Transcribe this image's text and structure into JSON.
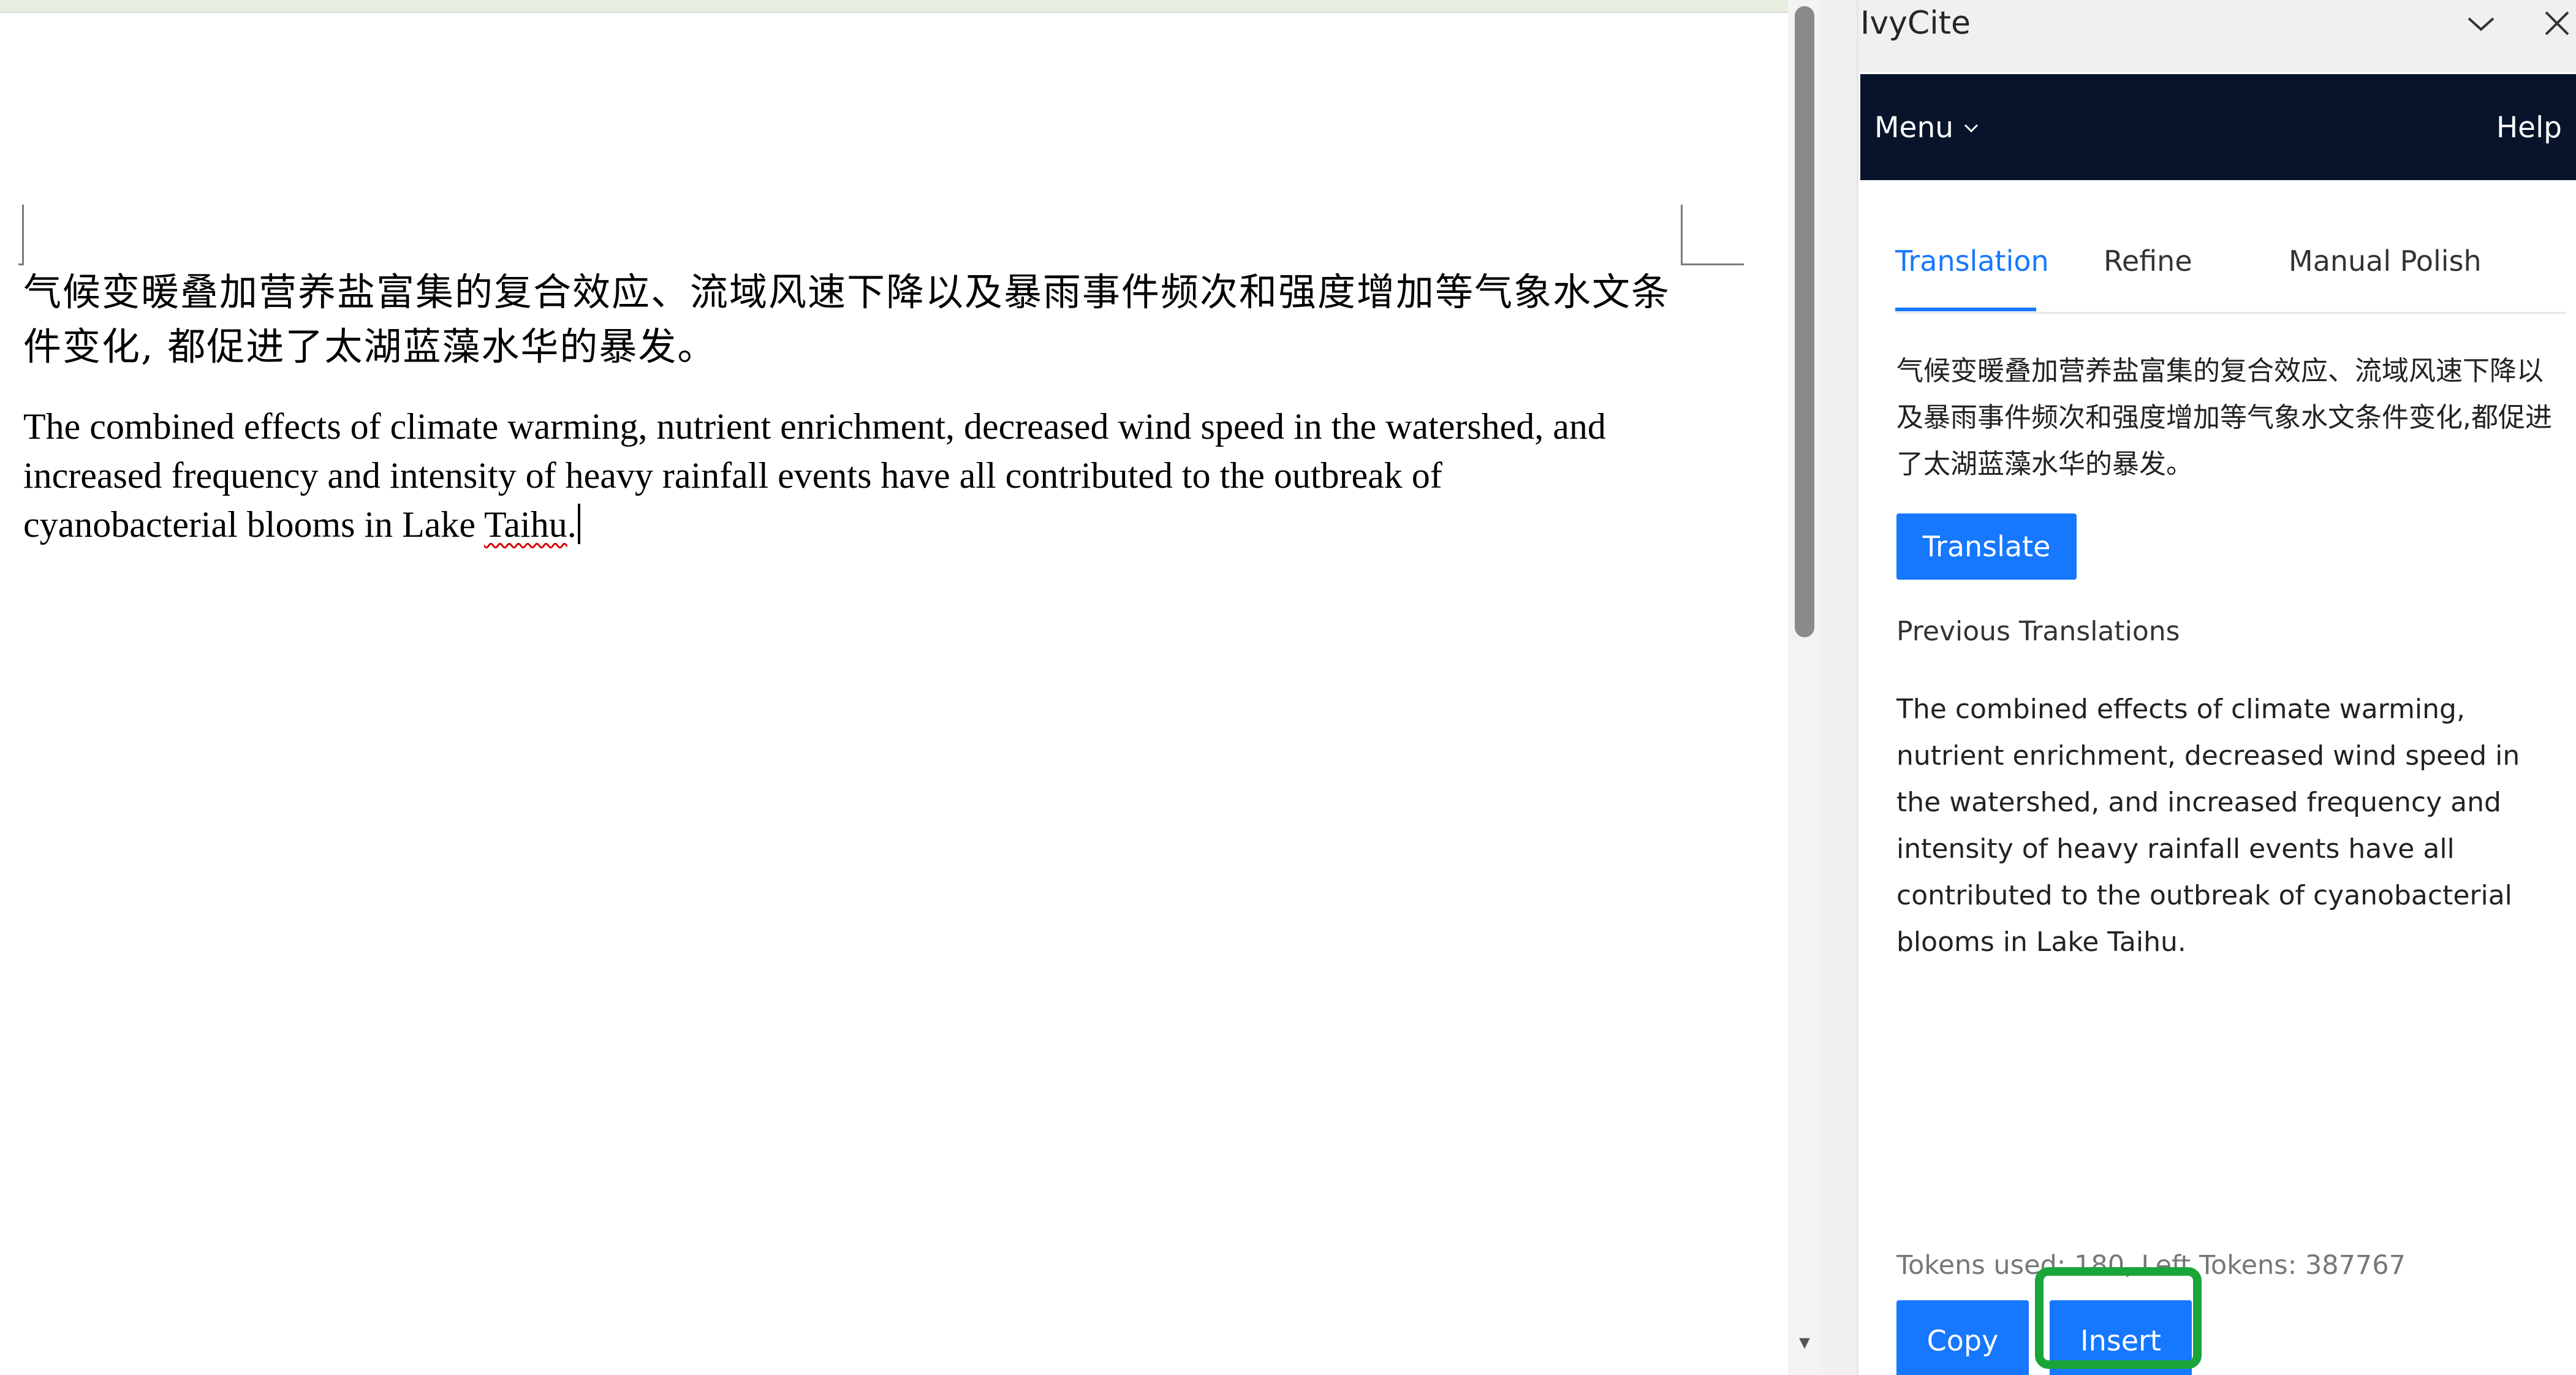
{
  "document": {
    "paragraph_cn": "气候变暖叠加营养盐富集的复合效应、流域风速下降以及暴雨事件频次和强度增加等气象水文条件变化, 都促进了太湖蓝藻水华的暴发。",
    "paragraph_en_main": "The combined effects of climate warming, nutrient enrichment, decreased wind speed in the watershed, and increased frequency and intensity of heavy rainfall events have all contributed to the outbreak of cyanobacterial blooms in Lake ",
    "paragraph_en_flagged_word": "Taihu",
    "paragraph_en_end": "."
  },
  "pane": {
    "title": "IvyCite",
    "collapse_icon": "chevron-down-icon",
    "close_icon": "close-icon",
    "nav": {
      "menu_label": "Menu",
      "help_label": "Help"
    },
    "tabs": [
      {
        "label": "Translation",
        "active": true
      },
      {
        "label": "Refine",
        "active": false
      },
      {
        "label": "Manual Polish",
        "active": false
      }
    ],
    "source_text": "气候变暖叠加营养盐富集的复合效应、流域风速下降以及暴雨事件频次和强度增加等气象水文条件变化,都促进了太湖蓝藻水华的暴发。",
    "translate_label": "Translate",
    "previous_heading": "Previous Translations",
    "previous_text": "The combined effects of climate warming, nutrient enrichment, decreased wind speed in the watershed, and increased frequency and intensity of heavy rainfall events have all contributed to the outbreak of cyanobacterial blooms in Lake Taihu.",
    "tokens_text": "Tokens used: 180, Left Tokens: 387767",
    "copy_label": "Copy",
    "insert_label": "Insert"
  },
  "colors": {
    "accent": "#1677ff",
    "nav_bg": "#07142a",
    "highlight": "#1aa53a",
    "spellcheck": "#d20000"
  }
}
